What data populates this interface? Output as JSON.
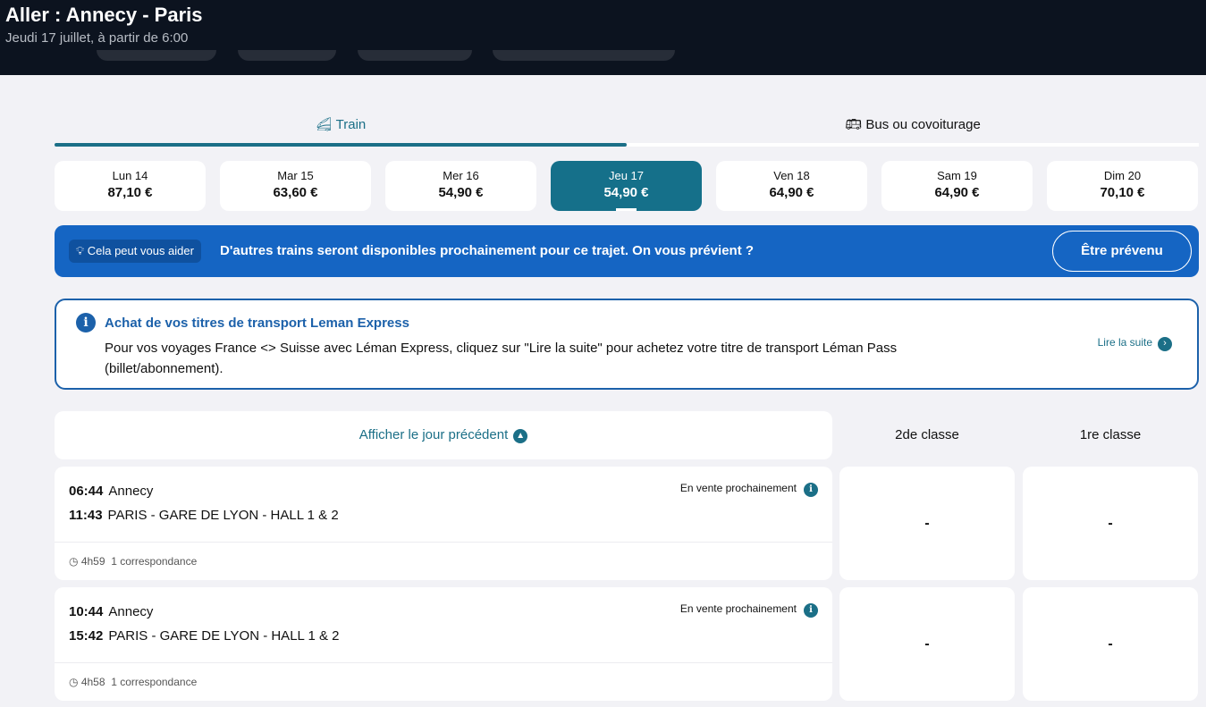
{
  "header": {
    "title": "Aller : Annecy - Paris",
    "subtitle": "Jeudi 17 juillet, à partir de 6:00"
  },
  "tabs": [
    {
      "label": "Train",
      "icon": "train-icon",
      "active": true
    },
    {
      "label": "Bus ou covoiturage",
      "icon": "bus-icon",
      "active": false
    }
  ],
  "days": [
    {
      "day": "Lun 14",
      "price": "87,10 €"
    },
    {
      "day": "Mar 15",
      "price": "63,60 €"
    },
    {
      "day": "Mer 16",
      "price": "54,90 €"
    },
    {
      "day": "Jeu 17",
      "price": "54,90 €"
    },
    {
      "day": "Ven 18",
      "price": "64,90 €"
    },
    {
      "day": "Sam 19",
      "price": "64,90 €"
    },
    {
      "day": "Dim 20",
      "price": "70,10 €"
    }
  ],
  "banner": {
    "tag": "Cela peut vous aider",
    "message": "D'autres trains seront disponibles prochainement pour ce trajet. On vous prévient ?",
    "button": "Être prévenu"
  },
  "info": {
    "title": "Achat de vos titres de transport Leman Express",
    "text": "Pour vos voyages France <> Suisse avec Léman Express, cliquez sur \"Lire la suite\" pour achetez votre titre de transport Léman Pass (billet/abonnement).",
    "link": "Lire la suite"
  },
  "results": {
    "previous_day": "Afficher le jour précédent",
    "class2": "2de classe",
    "class1": "1re classe",
    "trips": [
      {
        "dep_time": "06:44",
        "dep": "Annecy",
        "arr_time": "11:43",
        "arr": "PARIS - GARE DE LYON - HALL 1 & 2",
        "status": "En vente prochainement",
        "duration": "4h59",
        "changes": "1 correspondance",
        "price2": "-",
        "price1": "-"
      },
      {
        "dep_time": "10:44",
        "dep": "Annecy",
        "arr_time": "15:42",
        "arr": "PARIS - GARE DE LYON - HALL 1 & 2",
        "status": "En vente prochainement",
        "duration": "4h58",
        "changes": "1 correspondance",
        "price2": "-",
        "price1": "-"
      }
    ]
  }
}
